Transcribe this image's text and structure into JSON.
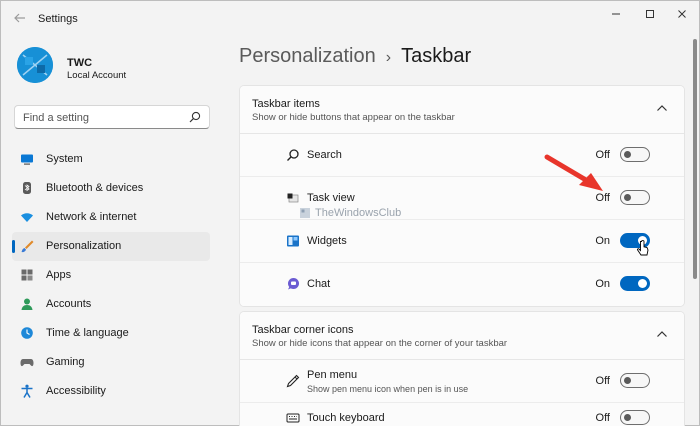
{
  "window": {
    "title": "Settings"
  },
  "account": {
    "name": "TWC",
    "type": "Local Account"
  },
  "search": {
    "placeholder": "Find a setting"
  },
  "nav": [
    {
      "label": "System",
      "icon": "monitor-icon",
      "active": false
    },
    {
      "label": "Bluetooth & devices",
      "icon": "bluetooth-icon",
      "active": false
    },
    {
      "label": "Network & internet",
      "icon": "wifi-icon",
      "active": false
    },
    {
      "label": "Personalization",
      "icon": "brush-icon",
      "active": true
    },
    {
      "label": "Apps",
      "icon": "apps-icon",
      "active": false
    },
    {
      "label": "Accounts",
      "icon": "person-icon",
      "active": false
    },
    {
      "label": "Time & language",
      "icon": "globe-clock-icon",
      "active": false
    },
    {
      "label": "Gaming",
      "icon": "gamepad-icon",
      "active": false
    },
    {
      "label": "Accessibility",
      "icon": "accessibility-icon",
      "active": false
    }
  ],
  "breadcrumb": {
    "parent": "Personalization",
    "separator": "›",
    "current": "Taskbar"
  },
  "sections": [
    {
      "title": "Taskbar items",
      "subtitle": "Show or hide buttons that appear on the taskbar",
      "items": [
        {
          "label": "Search",
          "state": "Off",
          "on": false,
          "icon": "search-icon"
        },
        {
          "label": "Task view",
          "state": "Off",
          "on": false,
          "icon": "task-view-icon"
        },
        {
          "label": "Widgets",
          "state": "On",
          "on": true,
          "icon": "widgets-icon"
        },
        {
          "label": "Chat",
          "state": "On",
          "on": true,
          "icon": "chat-icon"
        }
      ]
    },
    {
      "title": "Taskbar corner icons",
      "subtitle": "Show or hide icons that appear on the corner of your taskbar",
      "items": [
        {
          "label": "Pen menu",
          "description": "Show pen menu icon when pen is in use",
          "state": "Off",
          "on": false,
          "icon": "pen-icon"
        },
        {
          "label": "Touch keyboard",
          "state": "Off",
          "on": false,
          "icon": "keyboard-icon"
        }
      ]
    }
  ],
  "watermark": "TheWindowsClub",
  "colors": {
    "accent": "#0067c0",
    "annotation_arrow": "#e8352b"
  }
}
